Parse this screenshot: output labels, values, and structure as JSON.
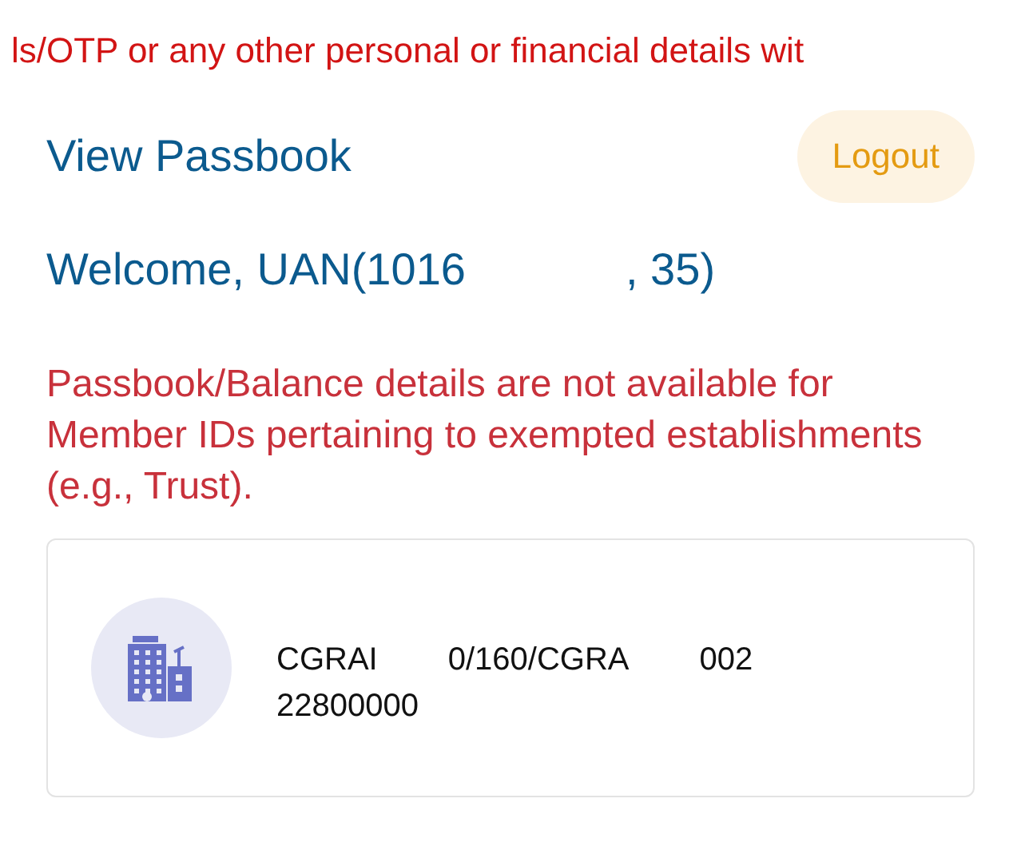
{
  "warning_banner": "ls/OTP or any other personal or financial details wit",
  "header": {
    "title": "View Passbook",
    "logout_button": "Logout"
  },
  "welcome": {
    "prefix": "Welcome, UAN(1016",
    "suffix": ", 35)"
  },
  "notice": "Passbook/Balance details are not available for Member IDs pertaining to exempted establishments (e.g., Trust).",
  "establishments": [
    {
      "code_parts": [
        "CGRAI",
        "0/160/CGRA",
        "002"
      ],
      "code_line_2": "22800000"
    }
  ]
}
